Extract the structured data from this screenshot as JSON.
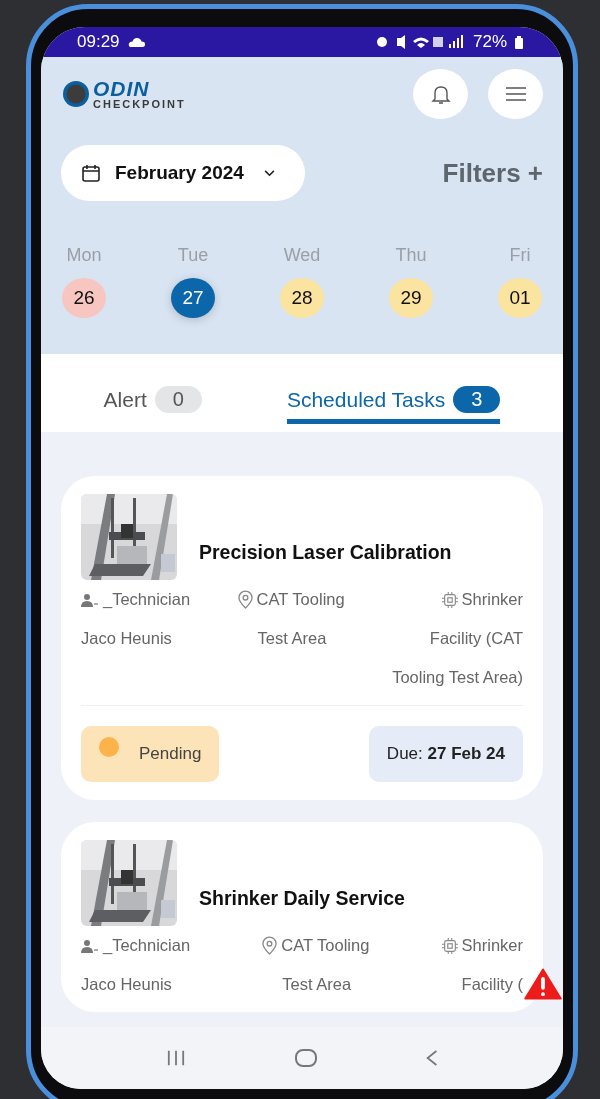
{
  "status_bar": {
    "time": "09:29",
    "battery": "72%"
  },
  "header": {
    "logo_top": "ODIN",
    "logo_bottom": "CHECKPOINT"
  },
  "month_picker": {
    "label": "February 2024"
  },
  "filters": {
    "label": "Filters +"
  },
  "days": [
    {
      "weekday": "Mon",
      "date": "26",
      "color": "#f7c6c1",
      "selected": false
    },
    {
      "weekday": "Tue",
      "date": "27",
      "color": "#0b67a9",
      "selected": true
    },
    {
      "weekday": "Wed",
      "date": "28",
      "color": "#fbe3a0",
      "selected": false
    },
    {
      "weekday": "Thu",
      "date": "29",
      "color": "#fbe3a0",
      "selected": false
    },
    {
      "weekday": "Fri",
      "date": "01",
      "color": "#fbe3a0",
      "selected": false
    }
  ],
  "tabs": [
    {
      "label": "Alert",
      "count": "0",
      "selected": false
    },
    {
      "label": "Scheduled Tasks",
      "count": "3",
      "selected": true
    }
  ],
  "tasks": [
    {
      "title": "Precision Laser Calibration",
      "technician": [
        "_Technician",
        "Jaco Heunis"
      ],
      "location": [
        "CAT Tooling",
        "Test Area"
      ],
      "asset": [
        "Shrinker",
        "Facility (CAT",
        "Tooling Test Area)"
      ],
      "status": {
        "label": "Pending",
        "color": "#fbb34a"
      },
      "due_label": "Due:",
      "due_date": "27 Feb 24"
    },
    {
      "title": "Shrinker Daily Service",
      "technician": [
        "_Technician",
        "Jaco Heunis"
      ],
      "location": [
        "CAT Tooling",
        "Test Area"
      ],
      "asset": [
        "Shrinker",
        "Facility ("
      ]
    }
  ]
}
